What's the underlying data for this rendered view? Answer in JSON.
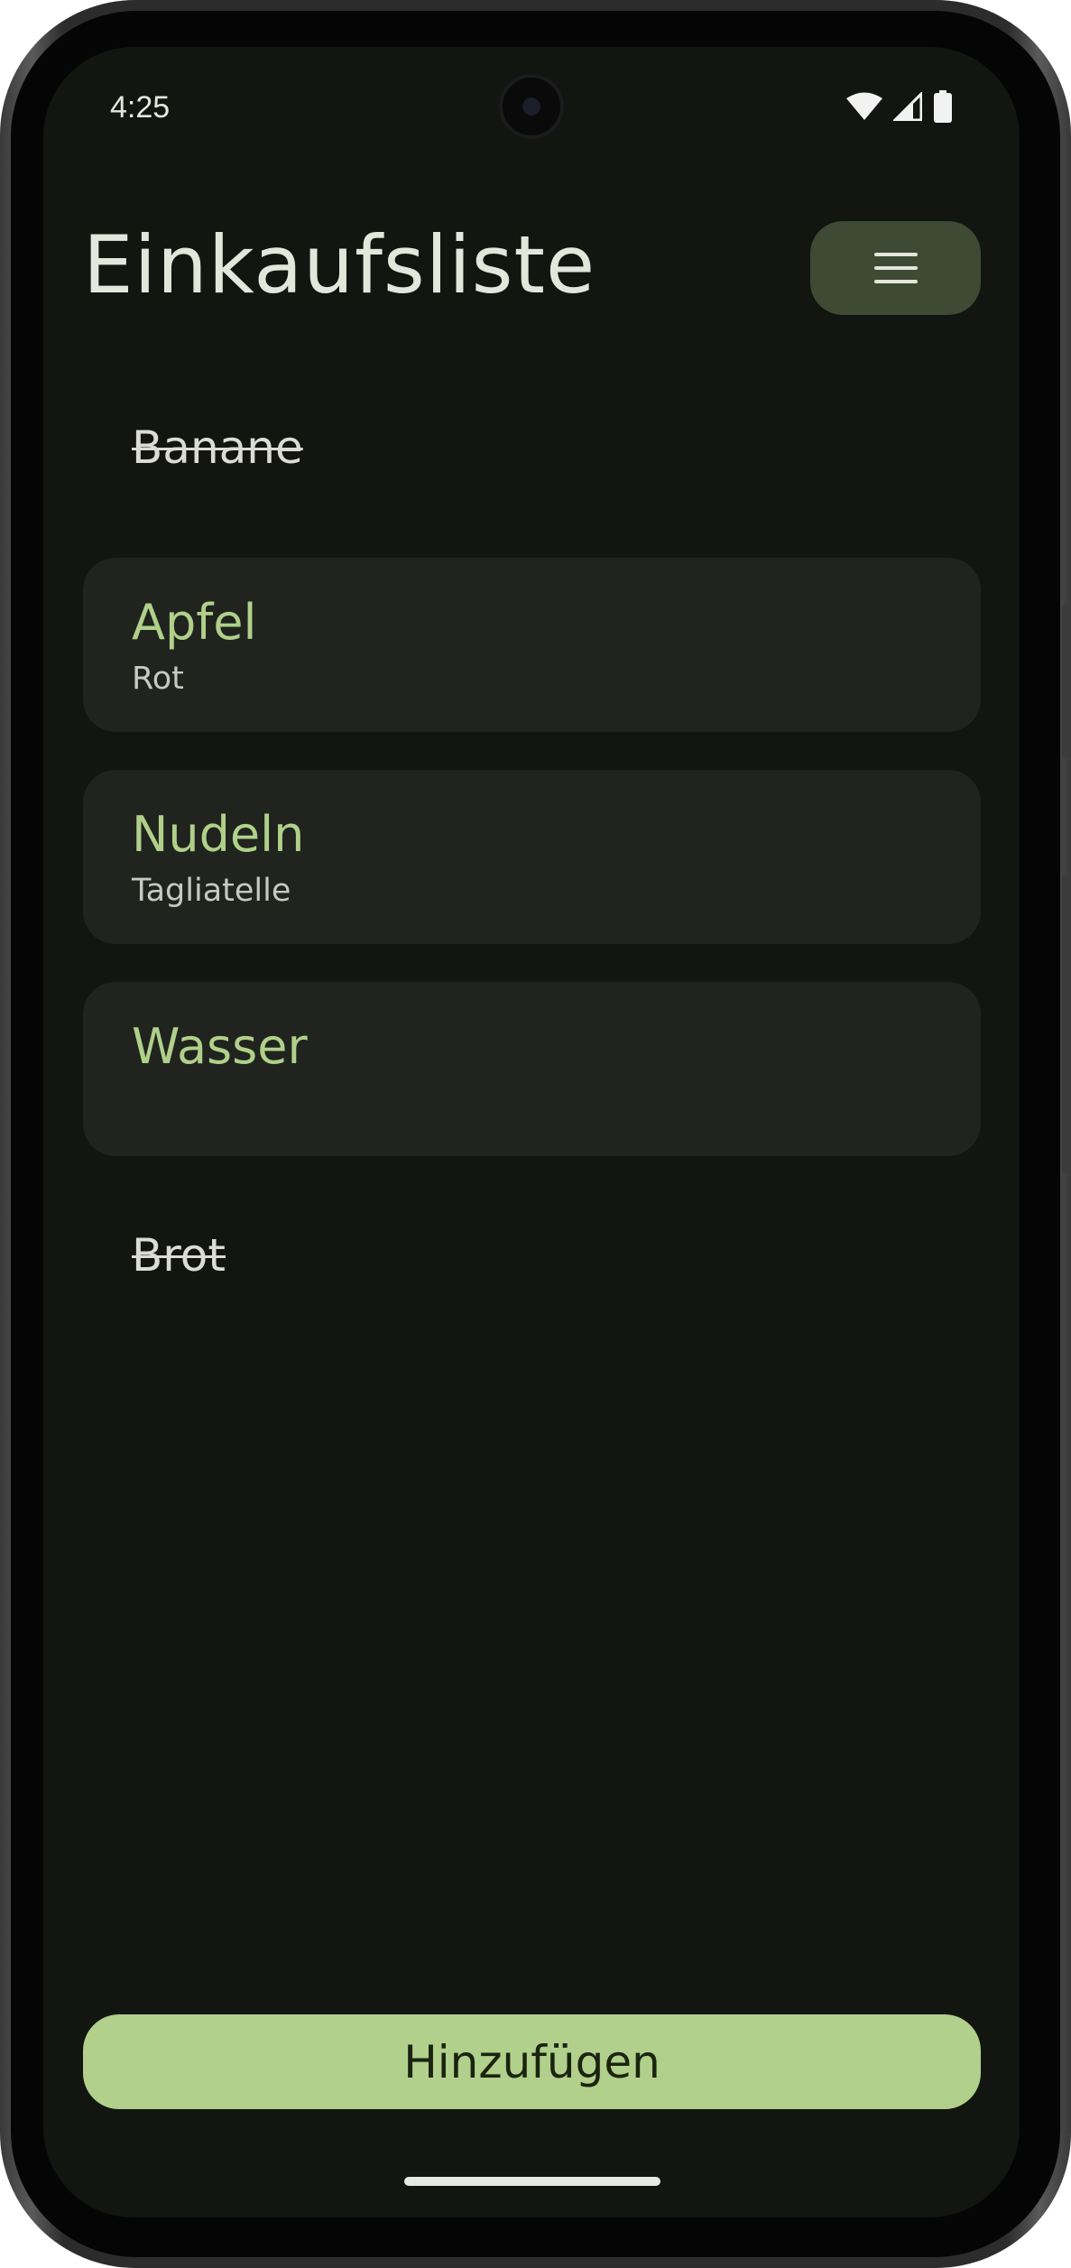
{
  "status_bar": {
    "time": "4:25"
  },
  "header": {
    "title": "Einkaufsliste",
    "menu_icon": "hamburger-menu-icon"
  },
  "items": [
    {
      "name": "Banane",
      "detail": "",
      "checked": true
    },
    {
      "name": "Apfel",
      "detail": "Rot",
      "checked": false
    },
    {
      "name": "Nudeln",
      "detail": "Tagliatelle",
      "checked": false
    },
    {
      "name": "Wasser",
      "detail": "",
      "checked": false
    },
    {
      "name": "Brot",
      "detail": "",
      "checked": true
    }
  ],
  "footer": {
    "add_label": "Hinzufügen"
  },
  "colors": {
    "background": "#121510",
    "card": "#20231e",
    "accent": "#b1d08b",
    "menu_button": "#3e4a34"
  }
}
